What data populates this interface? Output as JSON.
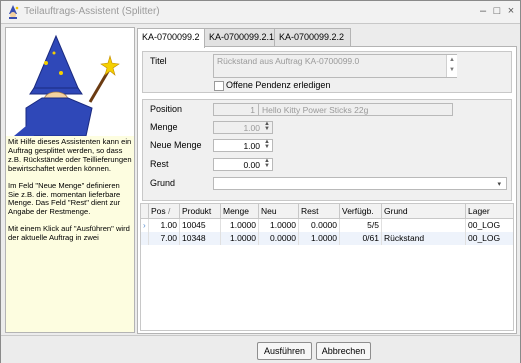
{
  "window": {
    "title": "Teilauftrags-Assistent (Splitter)"
  },
  "help": {
    "p1": "Mit Hilfe dieses Assistenten kann ein Auftrag gesplittet werden, so dass z.B. Rückstände oder Teillieferungen bewirtschaftet werden können.",
    "p2": "Im Feld \"Neue Menge\" definieren Sie z.B. die. momentan lieferbare Menge. Das Feld \"Rest\" dient zur Angabe der Restmenge.",
    "p3": "Mit einem Klick auf \"Ausführen\" wird der aktuelle Auftrag in zwei"
  },
  "tabs": [
    "KA-0700099.2",
    "KA-0700099.2.1",
    "KA-0700099.2.2"
  ],
  "form": {
    "titel_label": "Titel",
    "titel_value": "Rückstand aus Auftrag KA-0700099.0",
    "offene_label": "Offene Pendenz erledigen",
    "position_label": "Position",
    "position_num": "1",
    "position_text": "Hello Kitty Power Sticks 22g",
    "menge_label": "Menge",
    "menge_value": "1.00",
    "neue_menge_label": "Neue Menge",
    "neue_menge_value": "1.00",
    "rest_label": "Rest",
    "rest_value": "0.00",
    "grund_label": "Grund",
    "grund_value": ""
  },
  "grid": {
    "headers": [
      "Pos",
      "Produkt",
      "Menge",
      "Neu",
      "Rest",
      "Verfügb.",
      "Grund",
      "Lager"
    ],
    "rows": [
      [
        "1.00",
        "10045",
        "1.0000",
        "1.0000",
        "0.0000",
        "5/5",
        "",
        "00_LOG"
      ],
      [
        "7.00",
        "10348",
        "1.0000",
        "0.0000",
        "1.0000",
        "0/61",
        "Rückstand",
        "00_LOG"
      ]
    ]
  },
  "footer": {
    "execute_label": "Ausführen",
    "cancel_label": "Abbrechen"
  }
}
